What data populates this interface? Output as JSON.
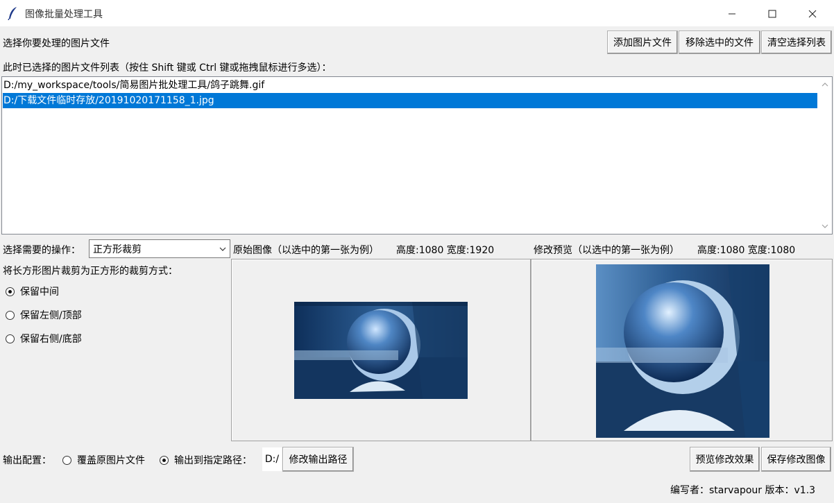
{
  "window": {
    "title": "图像批量处理工具"
  },
  "file_select": {
    "prompt": "选择你要处理的图片文件",
    "buttons": {
      "add": "添加图片文件",
      "remove": "移除选中的文件",
      "clear": "清空选择列表"
    },
    "list_caption": "此时已选择的图片文件列表（按住 Shift 键或 Ctrl 键或拖拽鼠标进行多选）：",
    "files": [
      "D:/my_workspace/tools/简易图片批处理工具/鸽子跳舞.gif",
      "D:/下载文件临时存放/20191020171158_1.jpg"
    ],
    "selected_index": 1
  },
  "operation": {
    "label": "选择需要的操作：",
    "selected": "正方形裁剪",
    "crop_caption": "将长方形图片裁剪为正方形的裁剪方式：",
    "options": [
      "保留中间",
      "保留左侧/顶部",
      "保留右侧/底部"
    ],
    "checked_index": 0
  },
  "original": {
    "caption": "原始图像（以选中的第一张为例）",
    "dims": "高度:1080 宽度:1920"
  },
  "preview": {
    "caption": "修改预览（以选中的第一张为例）",
    "dims": "高度:1080 宽度:1080"
  },
  "output": {
    "label": "输出配置：",
    "overwrite": "覆盖原图片文件",
    "to_path": "输出到指定路径：",
    "path": "D:/",
    "change_path": "修改输出路径",
    "checked": "to_path"
  },
  "actions": {
    "preview": "预览修改效果",
    "save": "保存修改图像"
  },
  "footer": {
    "author": "编写者：starvapour  版本：v1.3"
  },
  "colors": {
    "selection": "#0078d7",
    "window_bg": "#f0f0f0"
  }
}
